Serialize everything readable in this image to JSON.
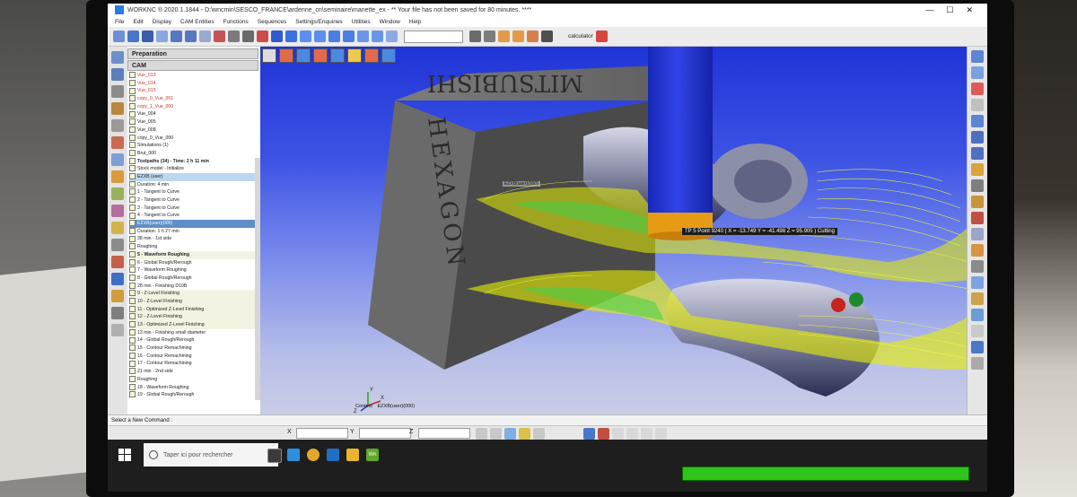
{
  "window": {
    "title": "WORKNC ® 2020.1.1844 - D:\\wncmin\\SESCO_FRANCE\\ardenne_cn\\seminaire\\manette_ex - ** Your file has not been saved for 80 minutes. ****",
    "min_label": "—",
    "max_label": "☐",
    "close_label": "✕"
  },
  "menu": [
    "File",
    "Edit",
    "Display",
    "CAM Entities",
    "Functions",
    "Sequences",
    "Settings/Enquiries",
    "Utilities",
    "Window",
    "Help"
  ],
  "toolbar": {
    "calculator_label": "calculator"
  },
  "left_panel": {
    "tab_preparation": "Preparation",
    "tab_cam": "CAM",
    "tree": [
      {
        "label": "Vue_013",
        "style": "red"
      },
      {
        "label": "Vue_014",
        "style": "red"
      },
      {
        "label": "Vue_015",
        "style": "red"
      },
      {
        "label": "copy_0_Vue_001",
        "style": "red"
      },
      {
        "label": "copy_1_Vue_000",
        "style": "red"
      },
      {
        "label": "Vue_004",
        "style": ""
      },
      {
        "label": "Vue_005",
        "style": ""
      },
      {
        "label": "Vue_008",
        "style": ""
      },
      {
        "label": "copy_0_Vue_000",
        "style": ""
      },
      {
        "label": "Simulations (1)",
        "style": ""
      },
      {
        "label": "Brut_000",
        "style": ""
      },
      {
        "label": "Toolpaths (34) - Time: 2 h 11 min",
        "style": "bold"
      },
      {
        "label": "Stock model - Initialize",
        "style": ""
      },
      {
        "label": "EZXB (user)",
        "style": "hl"
      },
      {
        "label": "Duration: 4 min",
        "style": ""
      },
      {
        "label": "1 - Tangent to Curve",
        "style": ""
      },
      {
        "label": "2 - Tangent to Curve",
        "style": ""
      },
      {
        "label": "3 - Tangent to Curve",
        "style": ""
      },
      {
        "label": "4 - Tangent to Curve",
        "style": ""
      },
      {
        "label": "EZXB(user)(000)",
        "style": "hl2"
      },
      {
        "label": "Duration: 1 h 27 min",
        "style": ""
      },
      {
        "label": "38 min - 1st side",
        "style": ""
      },
      {
        "label": "Roughing",
        "style": ""
      },
      {
        "label": "5 - Waveform Roughing",
        "style": "grp bold"
      },
      {
        "label": "6 - Global Rough/Rerough",
        "style": ""
      },
      {
        "label": "7 - Waveform Roughing",
        "style": ""
      },
      {
        "label": "8 - Global Rough/Rerough",
        "style": ""
      },
      {
        "label": "28 min - Finishing D10B",
        "style": ""
      },
      {
        "label": "9 - Z-Level Finishing",
        "style": "grp"
      },
      {
        "label": "10 - Z-Level Finishing",
        "style": "grp"
      },
      {
        "label": "11 - Optimized Z-Level Finishing",
        "style": "grp"
      },
      {
        "label": "12 - Z-Level Finishing",
        "style": "grp"
      },
      {
        "label": "13 - Optimized Z-Level Finishing",
        "style": "grp"
      },
      {
        "label": "13 min - Finishing small diameter",
        "style": ""
      },
      {
        "label": "14 - Global Rough/Rerough",
        "style": ""
      },
      {
        "label": "15 - Contour Remachining",
        "style": ""
      },
      {
        "label": "16 - Contour Remachining",
        "style": ""
      },
      {
        "label": "17 - Contour Remachining",
        "style": ""
      },
      {
        "label": "21 min - 2nd side",
        "style": ""
      },
      {
        "label": "Roughing",
        "style": ""
      },
      {
        "label": "18 - Waveform Roughing",
        "style": ""
      },
      {
        "label": "19 - Global Rough/Rerough",
        "style": ""
      }
    ]
  },
  "viewport": {
    "engraving_top": "MITSUBISHI",
    "engraving_side": "HEXAGON",
    "tooltip": "TP 5 Point 9240 ( X = -13.749  Y = -41.498  Z = 95.905 ) Cutting",
    "tool_label": "EZXB(user)(000)",
    "context_label": "Context",
    "context_value": "EZXB(user)(000)",
    "axis_x": "X",
    "axis_y": "Y",
    "axis_z": "Z"
  },
  "status": {
    "command_prompt": "Select a New Command :"
  },
  "coords": {
    "x_label": "X",
    "y_label": "Y",
    "z_label": "Z"
  },
  "taskbar": {
    "search_placeholder": "Taper ici pour rechercher",
    "app_label": "Wn"
  },
  "progress": {
    "value": 1.0
  },
  "colors": {
    "toolpath": "#e8f000",
    "toolpath_dense": "#3fd24a",
    "tool_shank": "#1c2fd8",
    "tool_holder": "#e79b14",
    "stock": "#5a5a5a",
    "progress": "#2fc41a"
  }
}
